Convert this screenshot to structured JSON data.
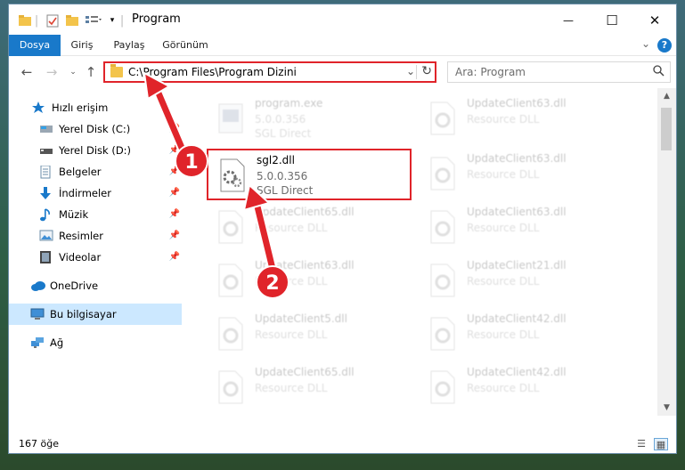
{
  "window": {
    "title": "Program",
    "minimize_glyph": "—",
    "maximize_glyph": "☐",
    "close_glyph": "✕"
  },
  "ribbon": {
    "tabs": [
      "Dosya",
      "Giriş",
      "Paylaş",
      "Görünüm"
    ],
    "help_glyph": "?"
  },
  "nav": {
    "address": "C:\\Program Files\\Program Dizini",
    "search_placeholder": "Ara: Program"
  },
  "sidebar": {
    "items": [
      {
        "label": "Hızlı erişim",
        "icon": "star-icon"
      },
      {
        "label": "Yerel Disk (C:)",
        "icon": "drive-icon"
      },
      {
        "label": "Yerel Disk (D:)",
        "icon": "drive-icon"
      },
      {
        "label": "Belgeler",
        "icon": "documents-icon"
      },
      {
        "label": "İndirmeler",
        "icon": "download-icon"
      },
      {
        "label": "Müzik",
        "icon": "music-icon"
      },
      {
        "label": "Resimler",
        "icon": "pictures-icon"
      },
      {
        "label": "Videolar",
        "icon": "videos-icon"
      },
      {
        "label": "OneDrive",
        "icon": "cloud-icon"
      },
      {
        "label": "Bu bilgisayar",
        "icon": "computer-icon"
      },
      {
        "label": "Ağ",
        "icon": "network-icon"
      }
    ]
  },
  "files": [
    {
      "name": "program.exe",
      "line1": "5.0.0.356",
      "line2": "SGL Direct"
    },
    {
      "name": "UpdateClient63.dll",
      "line1": "Resource DLL"
    },
    {
      "name": "sgl2.dll",
      "line1": "5.0.0.356",
      "line2": "SGL Direct"
    },
    {
      "name": "UpdateClient63.dll",
      "line1": "Resource DLL"
    },
    {
      "name": "UpdateClient65.dll",
      "line1": "Resource DLL"
    },
    {
      "name": "UpdateClient63.dll",
      "line1": "Resource DLL"
    },
    {
      "name": "UpdateClient63.dll",
      "line1": "Resource DLL"
    },
    {
      "name": "UpdateClient21.dll",
      "line1": "Resource DLL"
    },
    {
      "name": "UpdateClient5.dll",
      "line1": "Resource DLL"
    },
    {
      "name": "UpdateClient42.dll",
      "line1": "Resource DLL"
    },
    {
      "name": "UpdateClient65.dll",
      "line1": "Resource DLL"
    },
    {
      "name": "UpdateClient42.dll",
      "line1": "Resource DLL"
    }
  ],
  "status": {
    "count": "167 öğe"
  },
  "callouts": [
    "1",
    "2"
  ],
  "colors": {
    "accent": "#1979ca",
    "highlight": "#e0242a",
    "selected": "#cce8ff"
  }
}
